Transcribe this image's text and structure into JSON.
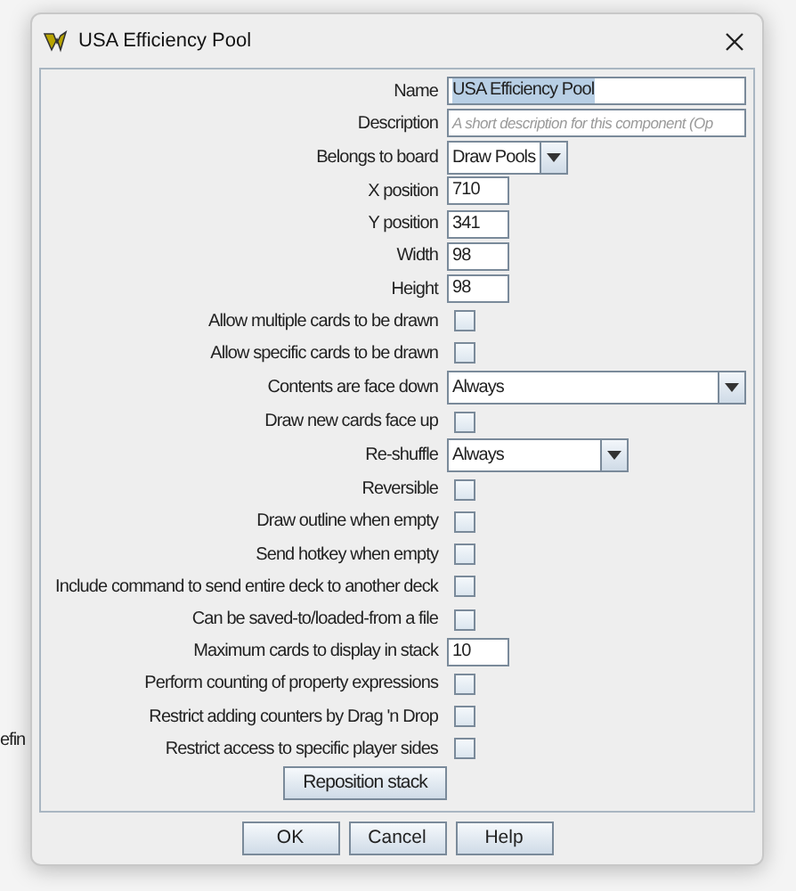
{
  "background_text": "efin",
  "window": {
    "title": "USA Efficiency Pool"
  },
  "rows": [
    {
      "kind": "text",
      "label": "Name",
      "value": "USA Efficiency Pool",
      "highlighted": true
    },
    {
      "kind": "text",
      "label": "Description",
      "placeholder": "A short description for this component (Op"
    },
    {
      "kind": "combo",
      "label": "Belongs to board",
      "value": "Draw Pools"
    },
    {
      "kind": "number",
      "label": "X position",
      "value": "710"
    },
    {
      "kind": "number",
      "label": "Y position",
      "value": "341"
    },
    {
      "kind": "number",
      "label": "Width",
      "value": "98"
    },
    {
      "kind": "number",
      "label": "Height",
      "value": "98"
    },
    {
      "kind": "checkbox",
      "label": "Allow multiple cards to be drawn",
      "checked": false
    },
    {
      "kind": "checkbox",
      "label": "Allow specific cards to be drawn",
      "checked": false
    },
    {
      "kind": "dropdown",
      "label": "Contents are face down",
      "value": "Always"
    },
    {
      "kind": "checkbox",
      "label": "Draw new cards face up",
      "checked": false
    },
    {
      "kind": "select",
      "label": "Re-shuffle",
      "value": "Always"
    },
    {
      "kind": "checkbox",
      "label": "Reversible",
      "checked": false
    },
    {
      "kind": "checkbox",
      "label": "Draw outline when empty",
      "checked": false
    },
    {
      "kind": "checkbox",
      "label": "Send hotkey when empty",
      "checked": false
    },
    {
      "kind": "checkbox",
      "label": "Include command to send entire deck to another deck",
      "checked": false
    },
    {
      "kind": "checkbox",
      "label": "Can be saved-to/loaded-from a file",
      "checked": false
    },
    {
      "kind": "number",
      "label": "Maximum cards to display in stack",
      "value": "10"
    },
    {
      "kind": "checkbox",
      "label": "Perform counting of property expressions",
      "checked": false
    },
    {
      "kind": "checkbox",
      "label": "Restrict adding counters by Drag 'n Drop",
      "checked": false
    },
    {
      "kind": "checkbox",
      "label": "Restrict access to specific player sides",
      "checked": false
    }
  ],
  "panel_button": "Reposition stack",
  "buttons": [
    "OK",
    "Cancel",
    "Help"
  ]
}
